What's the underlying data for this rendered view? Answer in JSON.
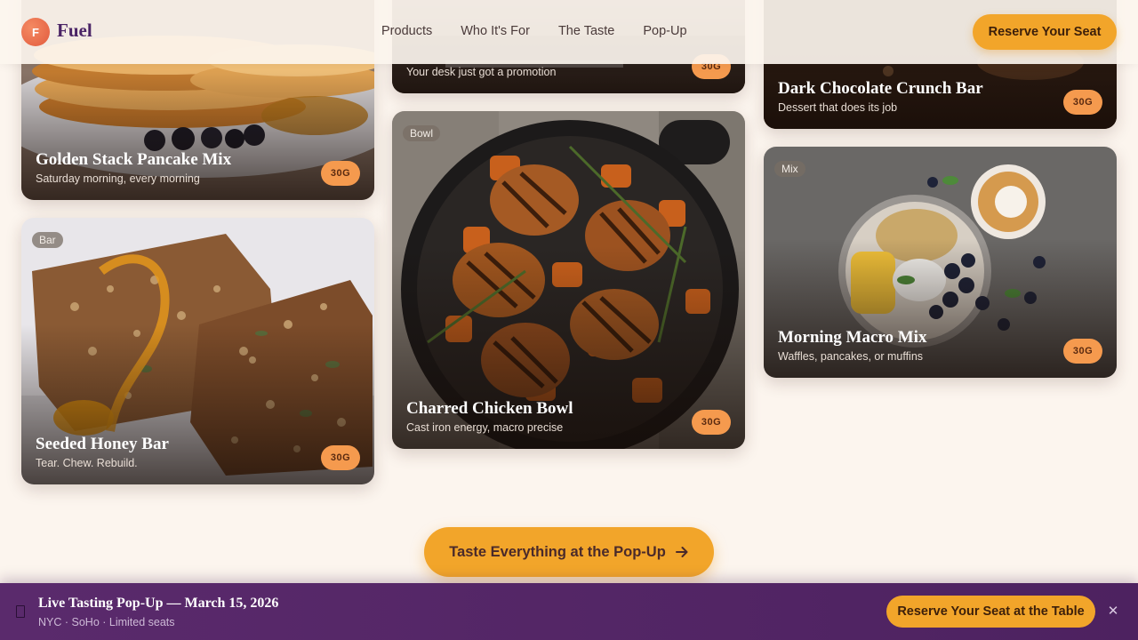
{
  "header": {
    "logo_letter": "F",
    "brand": "Fuel",
    "nav": [
      "Products",
      "Who It's For",
      "The Taste",
      "Pop-Up"
    ],
    "cta": "Reserve Your Seat"
  },
  "cards": [
    {
      "tag": "",
      "title": "Golden Stack Pancake Mix",
      "subtitle": "Saturday morning, every morning",
      "badge": "30G",
      "image": "pancake stack with blueberries"
    },
    {
      "tag": "Bar",
      "title": "Seeded Honey Bar",
      "subtitle": "Tear. Chew. Rebuild.",
      "badge": "30G",
      "image": "seeded honey bars"
    },
    {
      "tag": "",
      "title": "",
      "subtitle": "Your desk just got a promotion",
      "badge": "30G",
      "image": "desk snack"
    },
    {
      "tag": "Bowl",
      "title": "Charred Chicken Bowl",
      "subtitle": "Cast iron energy, macro precise",
      "badge": "30G",
      "image": "charred chicken in cast iron skillet"
    },
    {
      "tag": "",
      "title": "Dark Chocolate Crunch Bar",
      "subtitle": "Dessert that does its job",
      "badge": "30G",
      "image": "dark chocolate bar"
    },
    {
      "tag": "Mix",
      "title": "Morning Macro Mix",
      "subtitle": "Waffles, pancakes, or muffins",
      "badge": "30G",
      "image": "oats, mango, yogurt and blueberries bowl"
    }
  ],
  "main_cta": {
    "label": "Taste Everything at the Pop-Up",
    "icon": "arrow-right-icon"
  },
  "banner": {
    "title": "Live Tasting Pop-Up — March 15, 2026",
    "subtitle": "NYC · SoHo · Limited seats",
    "cta": "Reserve Your Seat at the Table",
    "close": "✕"
  },
  "colors": {
    "accent": "#f2a52a",
    "brand": "#4a2466",
    "badge": "#f59a4e",
    "banner": "#5a2a6c"
  }
}
